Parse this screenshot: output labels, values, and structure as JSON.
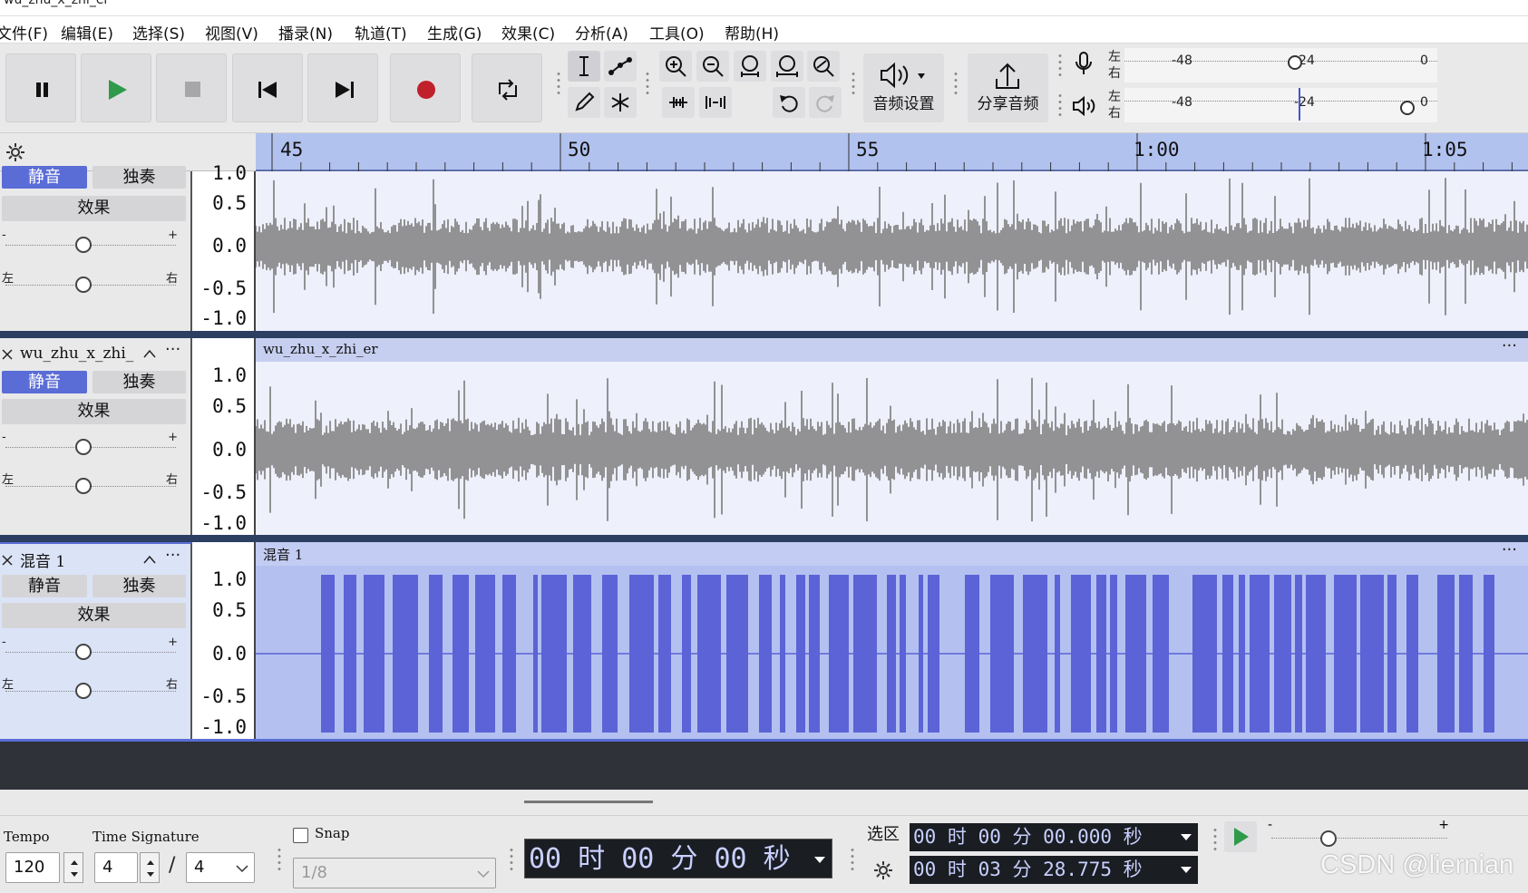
{
  "window": {
    "title": "wu_zhu_x_zhi_er"
  },
  "menu": [
    "文件(F)",
    "编辑(E)",
    "选择(S)",
    "视图(V)",
    "播录(N)",
    "轨道(T)",
    "生成(G)",
    "效果(C)",
    "分析(A)",
    "工具(O)",
    "帮助(H)"
  ],
  "toolbar": {
    "audio_setup_label": "音频设置",
    "share_audio_label": "分享音频",
    "rec_meter": {
      "left": "左",
      "right": "右",
      "ticks": [
        "-48",
        "-24",
        "0"
      ]
    },
    "play_meter": {
      "left": "左",
      "right": "右",
      "ticks": [
        "-48",
        "-24",
        "0"
      ]
    }
  },
  "ruler": {
    "labels": [
      "45",
      "50",
      "55",
      "1:00",
      "1:05"
    ]
  },
  "tracks": [
    {
      "name": "",
      "clip_title": "",
      "mute": "静音",
      "solo": "独奏",
      "effects": "效果",
      "gain_minus": "-",
      "gain_plus": "+",
      "pan_left": "左",
      "pan_right": "右",
      "scale": [
        "1.0",
        "0.5",
        "0.0",
        "-0.5",
        "-1.0"
      ],
      "gain_value": 0.5,
      "pan_value": 0.5,
      "color": "#7b7b7b"
    },
    {
      "name": "wu_zhu_x_zhi_",
      "clip_title": "wu_zhu_x_zhi_er",
      "mute": "静音",
      "solo": "独奏",
      "effects": "效果",
      "gain_minus": "-",
      "gain_plus": "+",
      "pan_left": "左",
      "pan_right": "右",
      "scale": [
        "1.0",
        "0.5",
        "0.0",
        "-0.5",
        "-1.0"
      ],
      "gain_value": 0.5,
      "pan_value": 0.5,
      "color": "#7b7b7b"
    },
    {
      "name": "混音 1",
      "clip_title": "混音 1",
      "mute": "静音",
      "solo": "独奏",
      "effects": "效果",
      "gain_minus": "-",
      "gain_plus": "+",
      "pan_left": "左",
      "pan_right": "右",
      "scale": [
        "1.0",
        "0.5",
        "0.0",
        "-0.5",
        "-1.0"
      ],
      "gain_value": 0.5,
      "pan_value": 0.5,
      "color": "#5b63d6"
    }
  ],
  "bottom": {
    "tempo_label": "Tempo",
    "tempo_value": "120",
    "time_sig_label": "Time Signature",
    "time_sig_num": "4",
    "time_sig_sep": "/",
    "time_sig_den": "4",
    "snap_label": "Snap",
    "snap_value": "1/8",
    "time_display": "00 时 00 分 00 秒",
    "selection_label": "选区",
    "sel_start": "00 时 00 分 00.000 秒",
    "sel_end": "00 时 03 分 28.775 秒",
    "watermark": "CSDN @liernian"
  },
  "colors": {
    "accent": "#5a6cd6",
    "ruler": "#b2c2ef",
    "record": "#c0202a",
    "play": "#2e9a4a"
  }
}
